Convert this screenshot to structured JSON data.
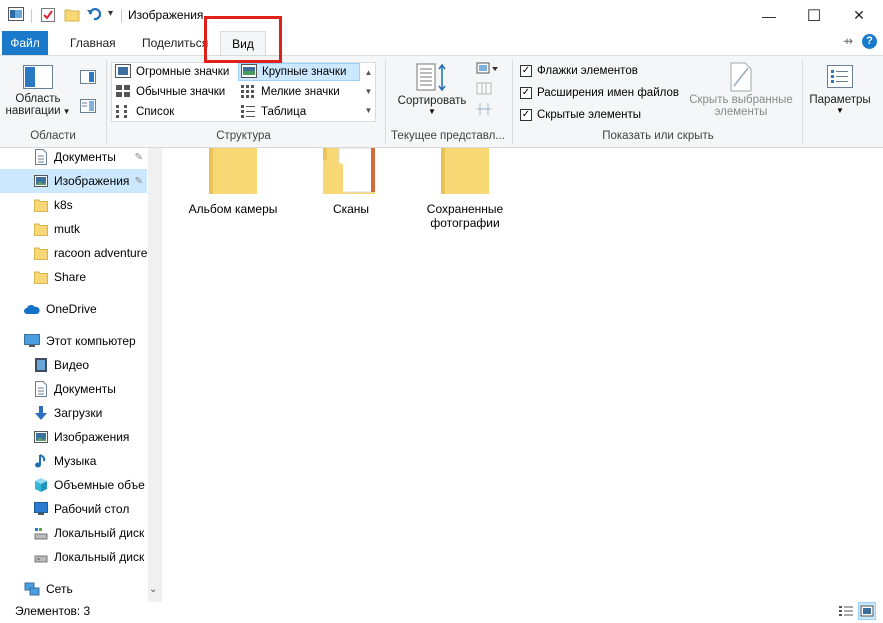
{
  "window": {
    "title": "Изображения",
    "minimize_glyph": "—",
    "maximize_glyph": "☐",
    "close_glyph": "✕",
    "help_glyph": "?"
  },
  "tabs": {
    "file": "Файл",
    "home": "Главная",
    "share": "Поделиться",
    "view": "Вид"
  },
  "ribbon": {
    "panes": {
      "nav_pane_line1": "Область",
      "nav_pane_line2": "навигации",
      "label": "Области"
    },
    "layout": {
      "items": [
        "Огромные значки",
        "Крупные значки",
        "Обычные значки",
        "Мелкие значки",
        "Список",
        "Таблица"
      ],
      "selected": "Крупные значки",
      "label": "Структура"
    },
    "current_view": {
      "sort_label": "Сортировать",
      "label": "Текущее представл..."
    },
    "show_hide": {
      "checkboxes": [
        "Флажки элементов",
        "Расширения имен файлов",
        "Скрытые элементы"
      ],
      "hide_selected_line1": "Скрыть выбранные",
      "hide_selected_line2": "элементы",
      "label": "Показать или скрыть"
    },
    "options_label": "Параметры"
  },
  "nav": {
    "quick_access": [
      {
        "label": "Документы",
        "icon": "document-icon",
        "pinned": true
      },
      {
        "label": "Изображения",
        "icon": "pictures-icon",
        "pinned": true
      },
      {
        "label": "k8s",
        "icon": "folder-icon"
      },
      {
        "label": "mutk",
        "icon": "folder-icon"
      },
      {
        "label": "racoon adventure",
        "icon": "folder-icon"
      },
      {
        "label": "Share",
        "icon": "folder-icon"
      }
    ],
    "onedrive": "OneDrive",
    "this_pc": "Этот компьютер",
    "pc_items": [
      {
        "label": "Видео",
        "icon": "video-icon"
      },
      {
        "label": "Документы",
        "icon": "document-icon"
      },
      {
        "label": "Загрузки",
        "icon": "download-icon"
      },
      {
        "label": "Изображения",
        "icon": "pictures-icon"
      },
      {
        "label": "Музыка",
        "icon": "music-icon"
      },
      {
        "label": "Объемные объе",
        "icon": "3d-objects-icon"
      },
      {
        "label": "Рабочий стол",
        "icon": "desktop-icon"
      },
      {
        "label": "Локальный диск",
        "icon": "drive-icon"
      },
      {
        "label": "Локальный диск",
        "icon": "drive-icon"
      }
    ],
    "network": "Сеть"
  },
  "content": {
    "folders": [
      {
        "name_line1": "Альбом камеры",
        "name_line2": ""
      },
      {
        "name_line1": "Сканы",
        "name_line2": ""
      },
      {
        "name_line1": "Сохраненные",
        "name_line2": "фотографии"
      }
    ]
  },
  "status": {
    "items_count": "Элементов: 3"
  },
  "colors": {
    "accent": "#1979ca",
    "highlight": "#e2201b",
    "selected": "#cce8ff",
    "folder": "#f8d775"
  }
}
